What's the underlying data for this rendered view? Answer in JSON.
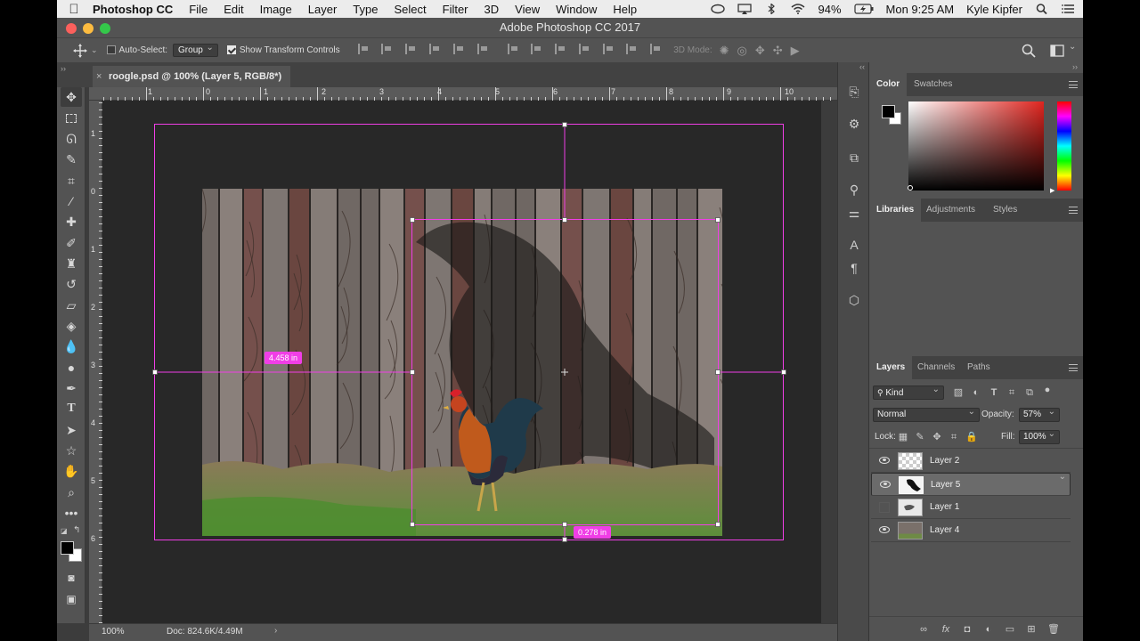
{
  "menubar": {
    "app_name": "Photoshop CC",
    "items": [
      "File",
      "Edit",
      "Image",
      "Layer",
      "Type",
      "Select",
      "Filter",
      "3D",
      "View",
      "Window",
      "Help"
    ],
    "battery": "94%",
    "clock": "Mon 9:25 AM",
    "user": "Kyle Kipfer"
  },
  "window": {
    "title": "Adobe Photoshop CC 2017"
  },
  "options": {
    "auto_select_label": "Auto-Select:",
    "auto_select_value": "Group",
    "show_transform_label": "Show Transform Controls",
    "mode_3d_label": "3D Mode:"
  },
  "document": {
    "tab_label": "roogle.psd @ 100% (Layer 5, RGB/8*)",
    "zoom": "100%",
    "doc_info": "Doc: 824.6K/4.49M"
  },
  "rulers": {
    "h_labels": [
      "1",
      "0",
      "1",
      "2",
      "3",
      "4",
      "5",
      "6",
      "7",
      "8",
      "9",
      "10"
    ],
    "v_labels": [
      "1",
      "0",
      "1",
      "2",
      "3",
      "4",
      "5",
      "6"
    ]
  },
  "measurements": {
    "left": "4.458 in",
    "bottom": "0.278 in"
  },
  "panels": {
    "color_tabs": [
      "Color",
      "Swatches"
    ],
    "library_tabs": [
      "Libraries",
      "Adjustments",
      "Styles"
    ],
    "layer_tabs": [
      "Layers",
      "Channels",
      "Paths"
    ],
    "kind_label": "Kind",
    "blend_mode": "Normal",
    "opacity_label": "Opacity:",
    "opacity_value": "57%",
    "lock_label": "Lock:",
    "fill_label": "Fill:",
    "fill_value": "100%",
    "layers": [
      {
        "name": "Layer 2",
        "visible": true,
        "selected": false
      },
      {
        "name": "Layer 5",
        "visible": true,
        "selected": true
      },
      {
        "name": "Layer 1",
        "visible": false,
        "selected": false
      },
      {
        "name": "Layer 4",
        "visible": true,
        "selected": false
      }
    ]
  },
  "colors": {
    "selection_magenta": "#f03ee6",
    "panel_bg": "#535353",
    "pasteboard": "#282828"
  }
}
